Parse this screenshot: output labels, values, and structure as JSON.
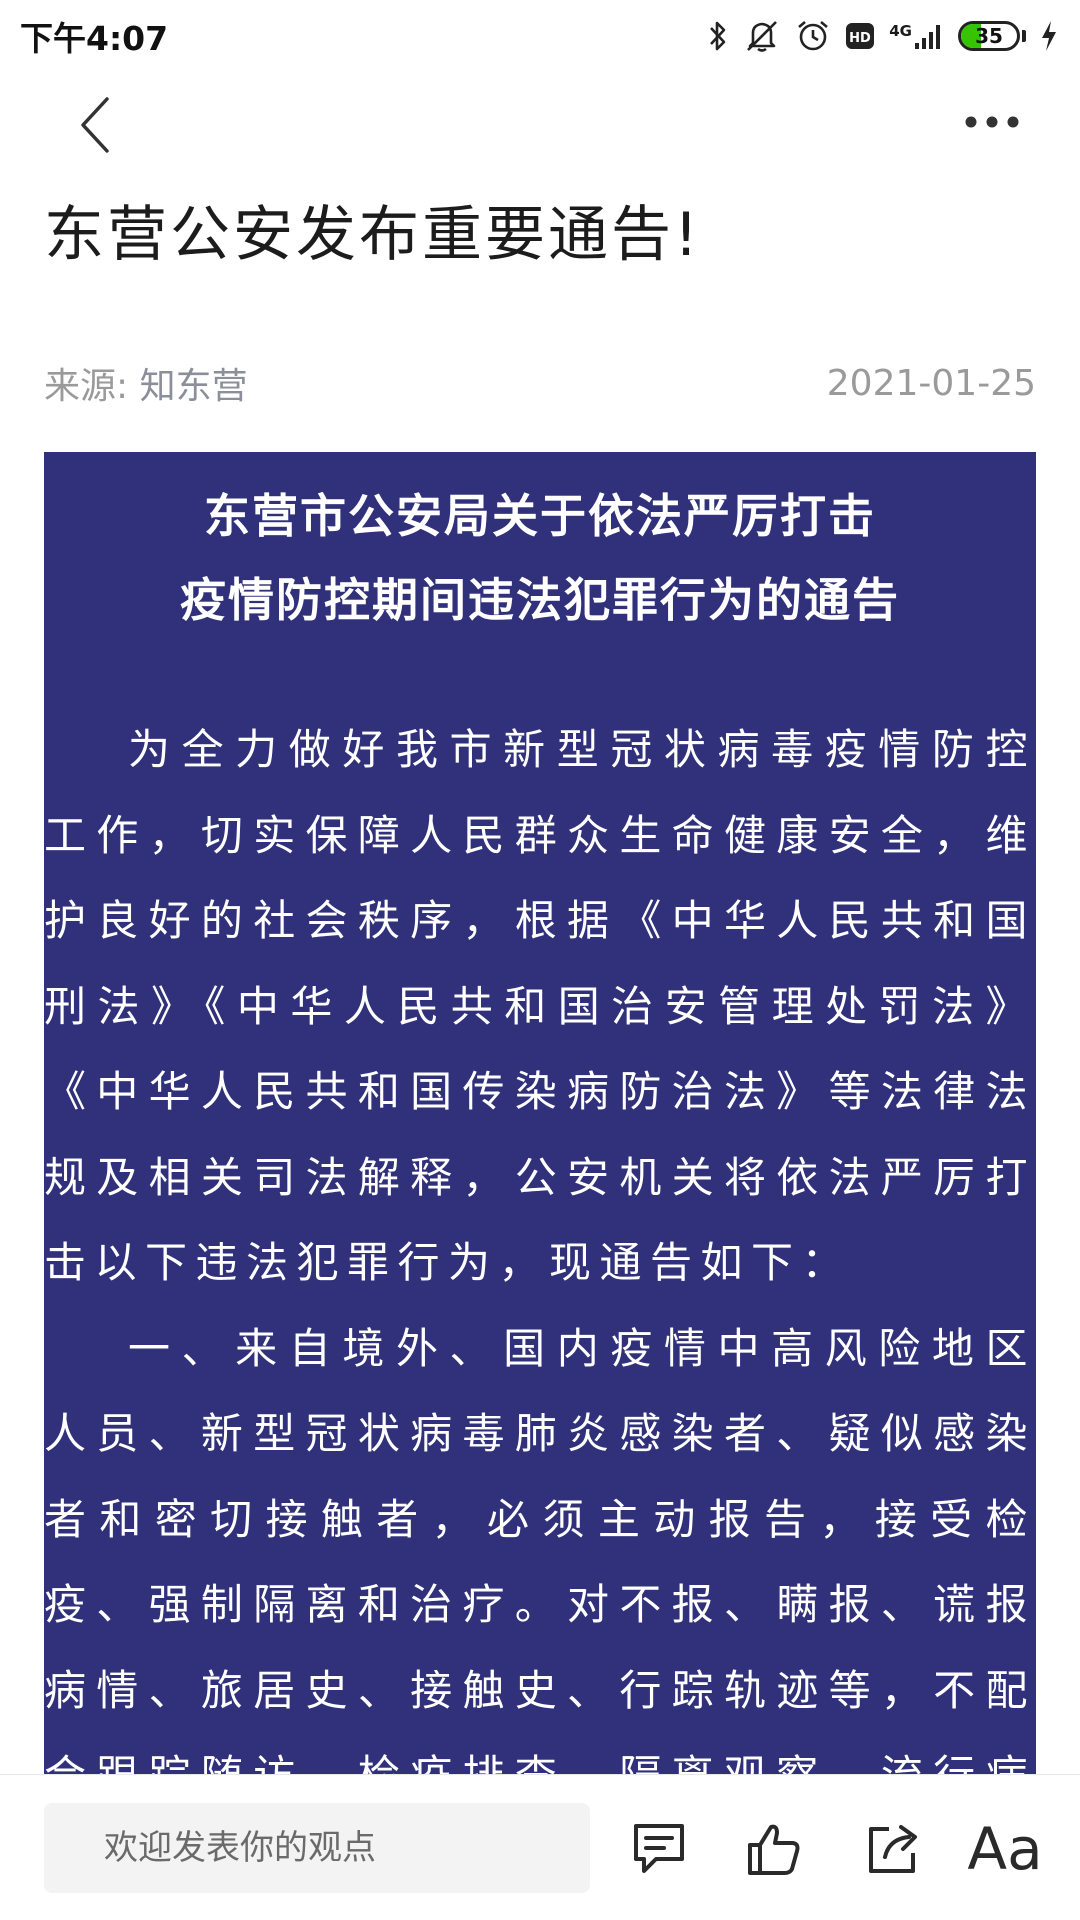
{
  "status_bar": {
    "time": "下午4:07",
    "network": "4G",
    "battery": "35",
    "battery_level_percent": 35,
    "icons": [
      "bluetooth-icon",
      "mute-icon",
      "alarm-icon",
      "hd-icon",
      "signal-icon",
      "battery-icon",
      "charging-icon"
    ]
  },
  "nav": {
    "back_icon": "chevron-left-icon",
    "more_icon": "more-horizontal-icon"
  },
  "article": {
    "title": "东营公安发布重要通告!",
    "source_label": "来源:",
    "source_name": "知东营",
    "date": "2021-01-25"
  },
  "notice": {
    "heading_line1": "东营市公安局关于依法严厉打击",
    "heading_line2": "疫情防控期间违法犯罪行为的通告",
    "paragraph1": "为全力做好我市新型冠状病毒疫情防控工作，切实保障人民群众生命健康安全，维护良好的社会秩序，根据《中华人民共和国刑法》《中华人民共和国治安管理处罚法》《中华人民共和国传染病防治法》等法律法规及相关司法解释，公安机关将依法严厉打击以下违法犯罪行为，现通告如下：",
    "paragraph2": "一、来自境外、国内疫情中高风险地区人员、新型冠状病毒肺炎感染者、疑似感染者和密切接触者，必须主动报告，接受检疫、强制隔离和治疗。对不报、瞒报、谎报病情、旅居史、接触史、行踪轨迹等，不配合跟踪随访、检疫排查、隔离观察、流行病学调查，扰乱疫情防控工作秩序"
  },
  "bottom_bar": {
    "comment_placeholder": "欢迎发表你的观点",
    "font_size_label": "Aa",
    "icons": [
      "comment-icon",
      "like-icon",
      "share-icon",
      "font-size-icon"
    ]
  },
  "colors": {
    "notice_background": "#30317a",
    "battery_fill": "#37c400",
    "meta_text": "#9a9a9a"
  }
}
